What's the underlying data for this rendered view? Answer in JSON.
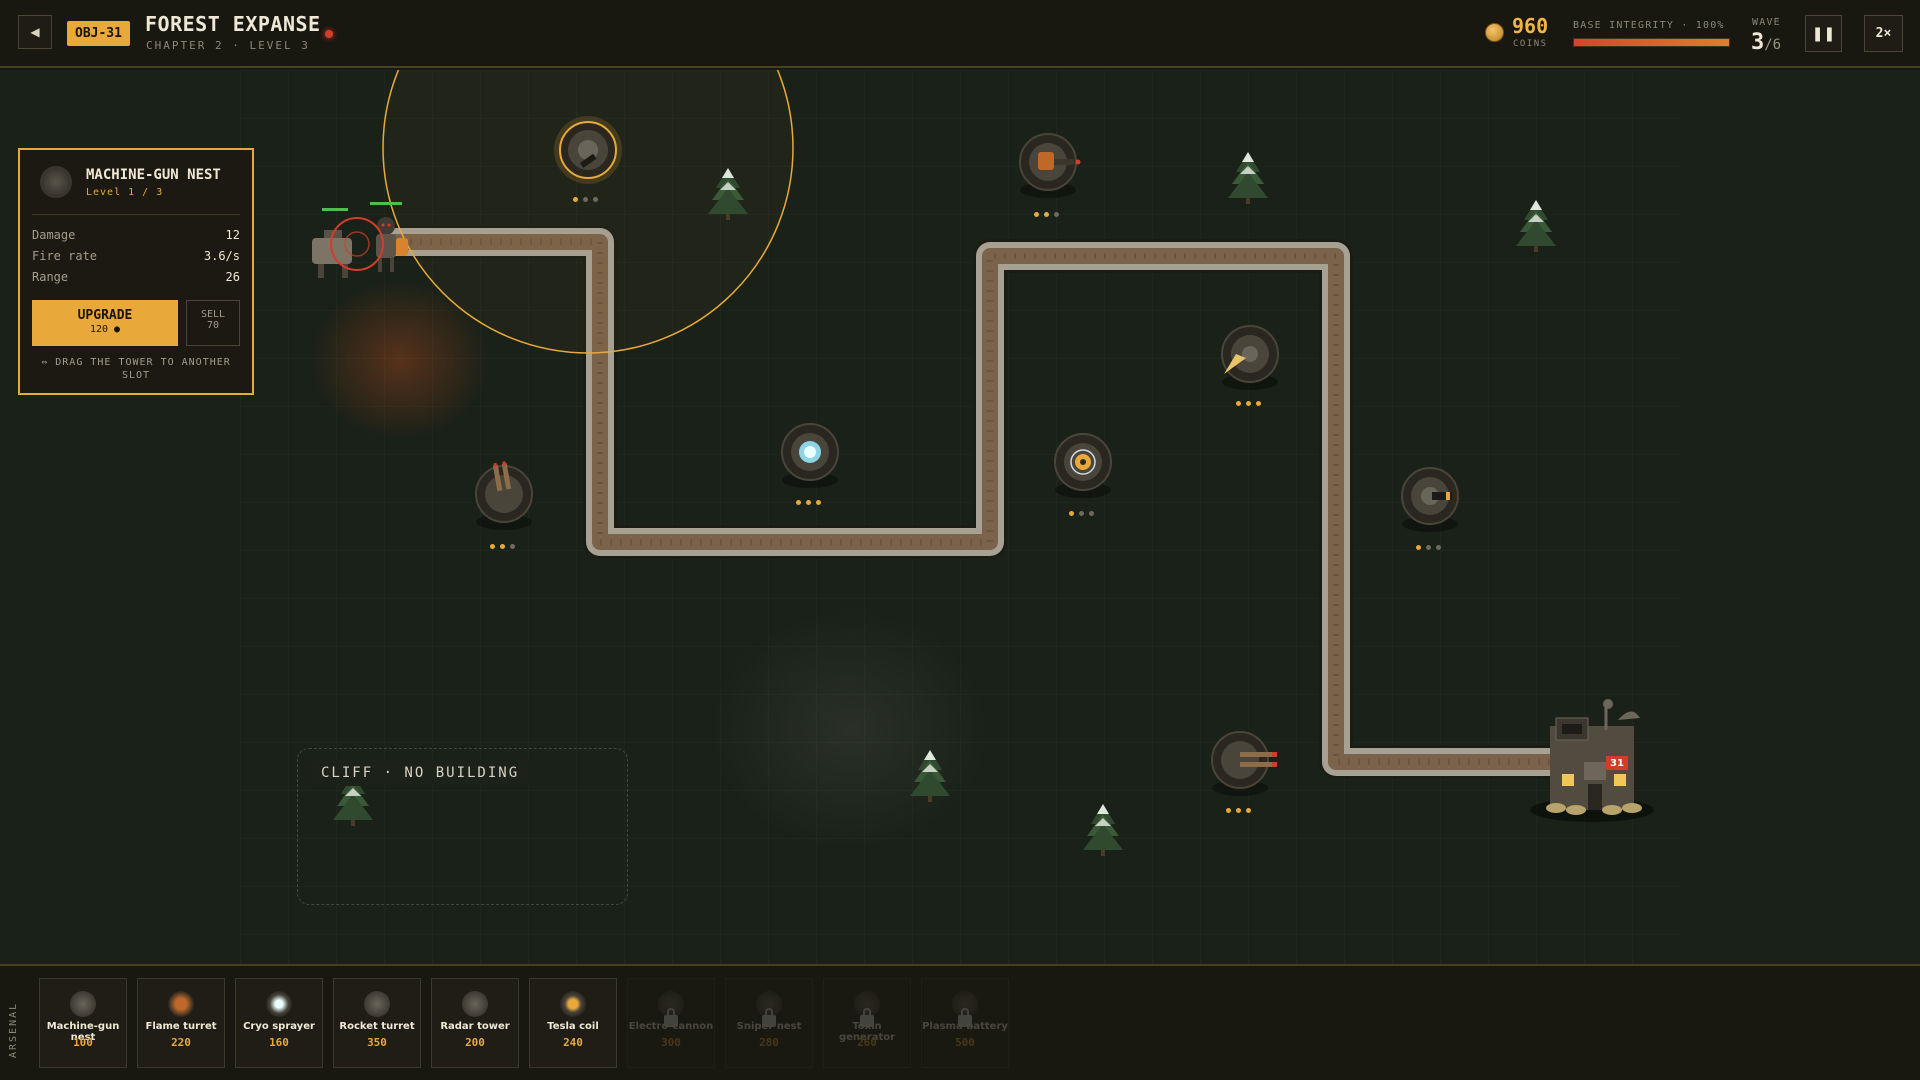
{
  "header": {
    "back_label": "◀",
    "objective_badge": "OBJ-31",
    "title": "FOREST EXPANSE",
    "subtitle": "CHAPTER 2 · LEVEL 3",
    "coins": "960",
    "coins_label": "COINS",
    "base_integrity_label": "BASE INTEGRITY · 100%",
    "base_integrity_percent": 100,
    "wave_label": "WAVE",
    "wave_current": "3",
    "wave_total": "/6",
    "pause_label": "❚❚",
    "speed_label": "2×"
  },
  "colors": {
    "accent": "#e8a93a",
    "path_stone": "#9a9587",
    "path_dirt": "#7a634a",
    "health": "#d5452c",
    "ground": "#1a2118"
  },
  "selected_tower": {
    "name": "MACHINE-GUN NEST",
    "level": "Level 1 / 3",
    "stats": [
      {
        "label": "Damage",
        "value": "12"
      },
      {
        "label": "Fire rate",
        "value": "3.6/s"
      },
      {
        "label": "Range",
        "value": "26"
      }
    ],
    "upgrade_label": "UPGRADE",
    "upgrade_cost": "120 ●",
    "sell_label": "SELL",
    "sell_value": "70",
    "hint": "⇔ DRAG THE TOWER TO ANOTHER SLOT"
  },
  "map": {
    "cliff_label": "CLIFF · NO BUILDING",
    "base_badge": "31",
    "towers": [
      {
        "id": "machine-gun-nest-selected",
        "type": "machine-gun-nest",
        "level": 1
      },
      {
        "id": "flame-turret-top",
        "type": "flame-turret",
        "level": 2
      },
      {
        "id": "rocket-turret-left",
        "type": "rocket-turret",
        "level": 2
      },
      {
        "id": "cryo-sprayer",
        "type": "cryo-sprayer",
        "level": 3
      },
      {
        "id": "tesla-coil",
        "type": "tesla-coil",
        "level": 1
      },
      {
        "id": "radar-tower",
        "type": "radar-tower",
        "level": 3
      },
      {
        "id": "machine-gun-nest-right",
        "type": "machine-gun-nest",
        "level": 1
      },
      {
        "id": "rocket-turret-bottom",
        "type": "rocket-turret",
        "level": 3
      }
    ]
  },
  "arsenal": {
    "label": "ARSENAL",
    "items": [
      {
        "name": "Machine-gun nest",
        "price": "100",
        "locked": false
      },
      {
        "name": "Flame turret",
        "price": "220",
        "locked": false
      },
      {
        "name": "Cryo sprayer",
        "price": "160",
        "locked": false
      },
      {
        "name": "Rocket turret",
        "price": "350",
        "locked": false
      },
      {
        "name": "Radar tower",
        "price": "200",
        "locked": false
      },
      {
        "name": "Tesla coil",
        "price": "240",
        "locked": false
      },
      {
        "name": "Electro-cannon",
        "price": "300",
        "locked": true
      },
      {
        "name": "Sniper nest",
        "price": "280",
        "locked": true
      },
      {
        "name": "Toxin generator",
        "price": "260",
        "locked": true
      },
      {
        "name": "Plasma battery",
        "price": "500",
        "locked": true
      }
    ]
  }
}
